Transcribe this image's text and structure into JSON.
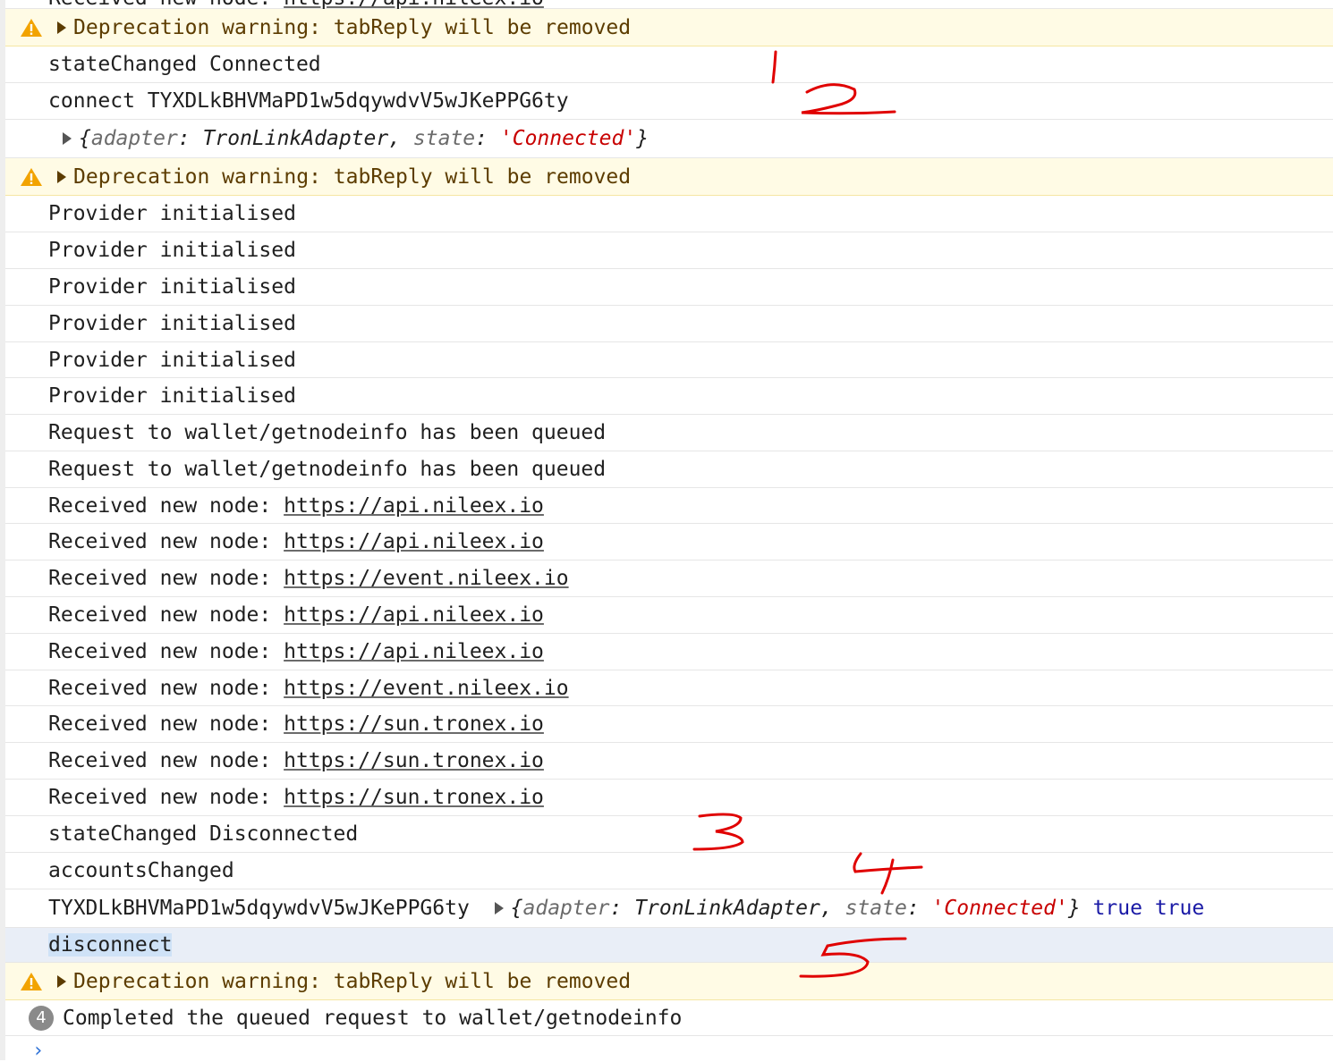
{
  "rows": {
    "r0": {
      "text": "Received new node: ",
      "link": "https://api.nileex.io"
    },
    "r1": {
      "text": "Deprecation warning: tabReply will be removed"
    },
    "r2": {
      "text": "stateChanged Connected"
    },
    "r3": {
      "text": "connect TYXDLkBHVMaPD1w5dqywdvV5wJKePPG6ty"
    },
    "r4": {
      "k1": "adapter",
      "v1": "TronLinkAdapter",
      "k2": "state",
      "v2": "'Connected'"
    },
    "r5": {
      "text": "Deprecation warning: tabReply will be removed"
    },
    "r6": {
      "text": "Provider initialised"
    },
    "r7": {
      "text": "Provider initialised"
    },
    "r8": {
      "text": "Provider initialised"
    },
    "r9": {
      "text": "Provider initialised"
    },
    "r10": {
      "text": "Provider initialised"
    },
    "r11": {
      "text": "Provider initialised"
    },
    "r12": {
      "text": "Request to wallet/getnodeinfo has been queued"
    },
    "r13": {
      "text": "Request to wallet/getnodeinfo has been queued"
    },
    "r14": {
      "text": "Received new node: ",
      "link": "https://api.nileex.io"
    },
    "r15": {
      "text": "Received new node: ",
      "link": "https://api.nileex.io"
    },
    "r16": {
      "text": "Received new node: ",
      "link": "https://event.nileex.io"
    },
    "r17": {
      "text": "Received new node: ",
      "link": "https://api.nileex.io"
    },
    "r18": {
      "text": "Received new node: ",
      "link": "https://api.nileex.io"
    },
    "r19": {
      "text": "Received new node: ",
      "link": "https://event.nileex.io"
    },
    "r20": {
      "text": "Received new node: ",
      "link": "https://sun.tronex.io"
    },
    "r21": {
      "text": "Received new node: ",
      "link": "https://sun.tronex.io"
    },
    "r22": {
      "text": "Received new node: ",
      "link": "https://sun.tronex.io"
    },
    "r23": {
      "text": "stateChanged Disconnected"
    },
    "r24": {
      "text": "accountsChanged"
    },
    "r25": {
      "text": "TYXDLkBHVMaPD1w5dqywdvV5wJKePPG6ty ",
      "k1": "adapter",
      "v1": "TronLinkAdapter",
      "k2": "state",
      "v2": "'Connected'",
      "b1": "true",
      "b2": "true"
    },
    "r26": {
      "text": "disconnect"
    },
    "r27": {
      "text": "Deprecation warning: tabReply will be removed"
    },
    "r28": {
      "count": "4",
      "text": "Completed the queued request to wallet/getnodeinfo"
    }
  },
  "prompt": "›",
  "colors": {
    "warning_bg": "#fffbe5",
    "warning_text": "#5c3c00",
    "string": "#c80000",
    "boolean": "#1a1aa6",
    "annotation": "#e00000",
    "selection": "#cfe2f7"
  },
  "icons": [
    "warning-icon",
    "expand-triangle-icon",
    "repeat-count-badge",
    "prompt-chevron-icon"
  ],
  "annotations": [
    "1",
    "2",
    "3",
    "4",
    "5"
  ]
}
